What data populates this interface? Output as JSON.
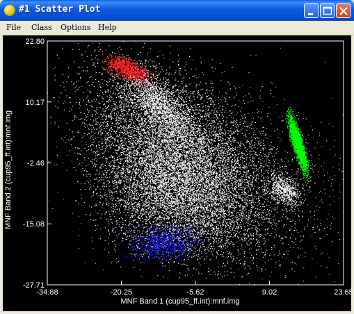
{
  "window": {
    "title": "#1 Scatter Plot",
    "buttons": {
      "minimize": "minimize",
      "maximize": "maximize",
      "close": "close"
    }
  },
  "menu": {
    "items": [
      "File",
      "Class",
      "Options",
      "Help"
    ]
  },
  "chart_data": {
    "type": "scatter",
    "xlabel": "MNF Band 1 (cup95_ff.int):mnf.img",
    "ylabel": "MNF Band 2 (cup95_ff.int):mnf.img",
    "xlim": [
      -34.88,
      23.65
    ],
    "ylim": [
      -27.71,
      22.8
    ],
    "x_ticks": [
      "-34.88",
      "-20.25",
      "-5.62",
      "9.02",
      "23.65"
    ],
    "y_ticks": [
      "22.80",
      "10.17",
      "-2.46",
      "-15.08",
      "-27.71"
    ],
    "background": "#000000",
    "series": [
      {
        "color": "#ffffff",
        "points": [
          [
            -18,
            10
          ],
          [
            -10,
            4
          ],
          [
            -4,
            0
          ],
          [
            2,
            -4
          ],
          [
            8,
            -8
          ],
          [
            -6,
            -10
          ],
          [
            -12,
            -6
          ],
          [
            -2,
            -16
          ],
          [
            14,
            -9
          ]
        ]
      },
      {
        "color": "#ff0000",
        "points": [
          [
            -22,
            18.5
          ],
          [
            -20,
            17
          ],
          [
            -18,
            16
          ],
          [
            -16,
            15.5
          ],
          [
            -19,
            18
          ]
        ]
      },
      {
        "color": "#00ff00",
        "points": [
          [
            13.2,
            5
          ],
          [
            14.0,
            3
          ],
          [
            14.8,
            1
          ],
          [
            15.5,
            -1
          ],
          [
            16.2,
            -3
          ]
        ]
      },
      {
        "color": "#0000ff",
        "points": [
          [
            -16,
            -18
          ],
          [
            -13,
            -19
          ],
          [
            -10,
            -20
          ],
          [
            -8,
            -22
          ],
          [
            -12,
            -23
          ]
        ]
      }
    ]
  }
}
